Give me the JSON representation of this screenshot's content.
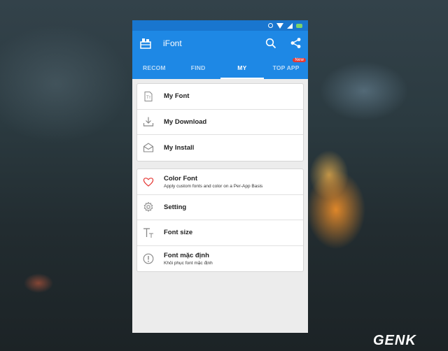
{
  "app": {
    "title": "iFont"
  },
  "tabs": [
    {
      "label": "RECOM"
    },
    {
      "label": "FIND"
    },
    {
      "label": "MY"
    },
    {
      "label": "TOP APP",
      "badge": "New"
    }
  ],
  "active_tab": "MY",
  "group1": [
    {
      "title": "My Font",
      "icon": "font-file-icon"
    },
    {
      "title": "My Download",
      "icon": "download-icon"
    },
    {
      "title": "My Install",
      "icon": "install-inbox-icon"
    }
  ],
  "group2": [
    {
      "title": "Color Font",
      "subtitle": "Apply custom fonts and color on a Per-App Basis",
      "icon": "heart-icon"
    },
    {
      "title": "Setting",
      "icon": "gear-icon"
    },
    {
      "title": "Font size",
      "icon": "text-size-icon"
    },
    {
      "title": "Font mặc định",
      "subtitle": "Khôi phục font mặc định",
      "icon": "info-icon"
    }
  ],
  "watermark": "GENK",
  "colors": {
    "primary": "#1e88e5",
    "statusbar": "#1976cf",
    "badge": "#e53935",
    "heart": "#e53935"
  }
}
